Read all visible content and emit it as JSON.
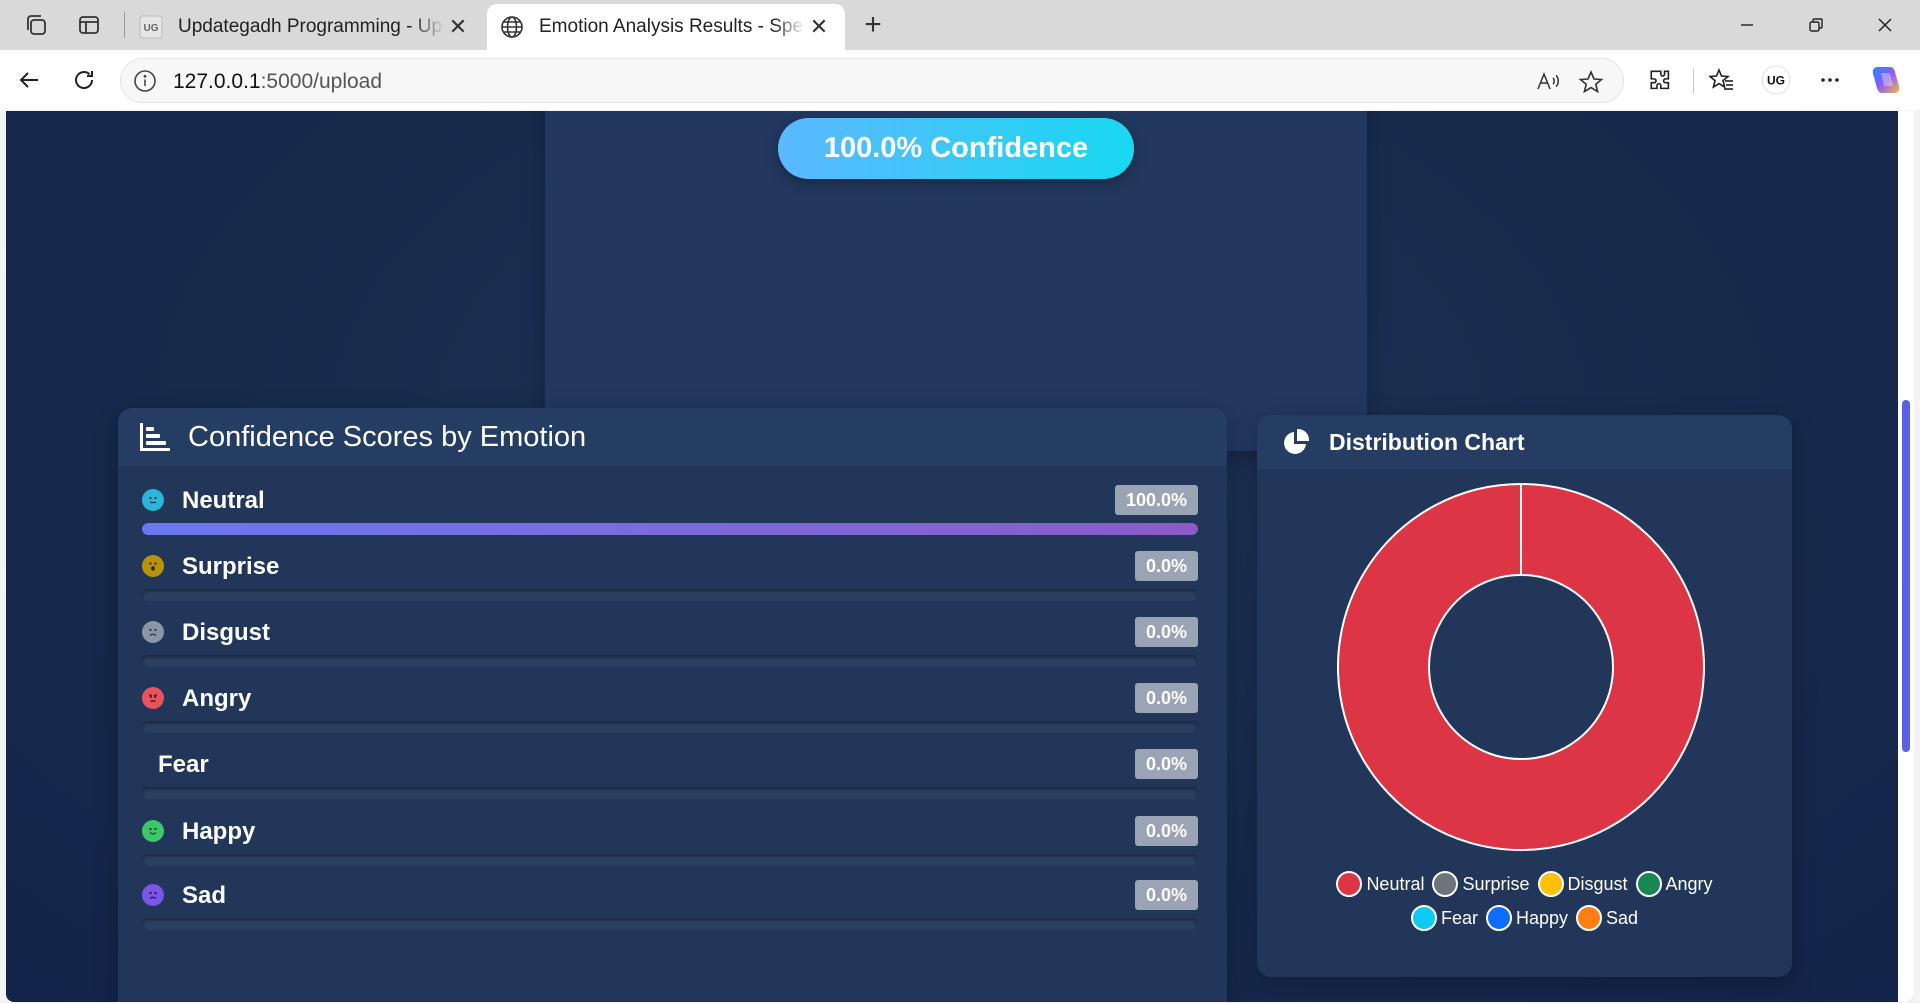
{
  "browser": {
    "tabs": [
      {
        "title": "Updategadh Programming - Upd",
        "favicon": "UG",
        "active": false
      },
      {
        "title": "Emotion Analysis Results - Speech",
        "favicon": "globe-icon",
        "active": true
      }
    ],
    "url_host": "127.0.0.1",
    "url_path": ":5000/upload",
    "profile_badge": "UG"
  },
  "hero": {
    "confidence_label": "100.0% Confidence"
  },
  "scores": {
    "title": "Confidence Scores by Emotion",
    "items": [
      {
        "name": "Neutral",
        "pct_label": "100.0%",
        "value": 100,
        "icon": "neutral-face-icon",
        "color": "#2bb5d8"
      },
      {
        "name": "Surprise",
        "pct_label": "0.0%",
        "value": 0,
        "icon": "surprised-face-icon",
        "color": "#b8920a"
      },
      {
        "name": "Disgust",
        "pct_label": "0.0%",
        "value": 0,
        "icon": "frowning-face-icon",
        "color": "#8a96a8"
      },
      {
        "name": "Angry",
        "pct_label": "0.0%",
        "value": 0,
        "icon": "angry-face-icon",
        "color": "#e8545c"
      },
      {
        "name": "Fear",
        "pct_label": "0.0%",
        "value": 0,
        "icon": "",
        "color": ""
      },
      {
        "name": "Happy",
        "pct_label": "0.0%",
        "value": 0,
        "icon": "smiling-face-icon",
        "color": "#3cc86a"
      },
      {
        "name": "Sad",
        "pct_label": "0.0%",
        "value": 0,
        "icon": "sad-face-icon",
        "color": "#7a55e6"
      }
    ]
  },
  "distribution": {
    "title": "Distribution Chart"
  },
  "chart_data": {
    "type": "pie",
    "variant": "doughnut",
    "categories": [
      "Neutral",
      "Surprise",
      "Disgust",
      "Angry",
      "Fear",
      "Happy",
      "Sad"
    ],
    "values": [
      100,
      0,
      0,
      0,
      0,
      0,
      0
    ],
    "colors": [
      "#dc3545",
      "#6c757d",
      "#ffc107",
      "#198754",
      "#0dcaf0",
      "#0d6efd",
      "#fd7e14"
    ],
    "legend_position": "bottom"
  }
}
